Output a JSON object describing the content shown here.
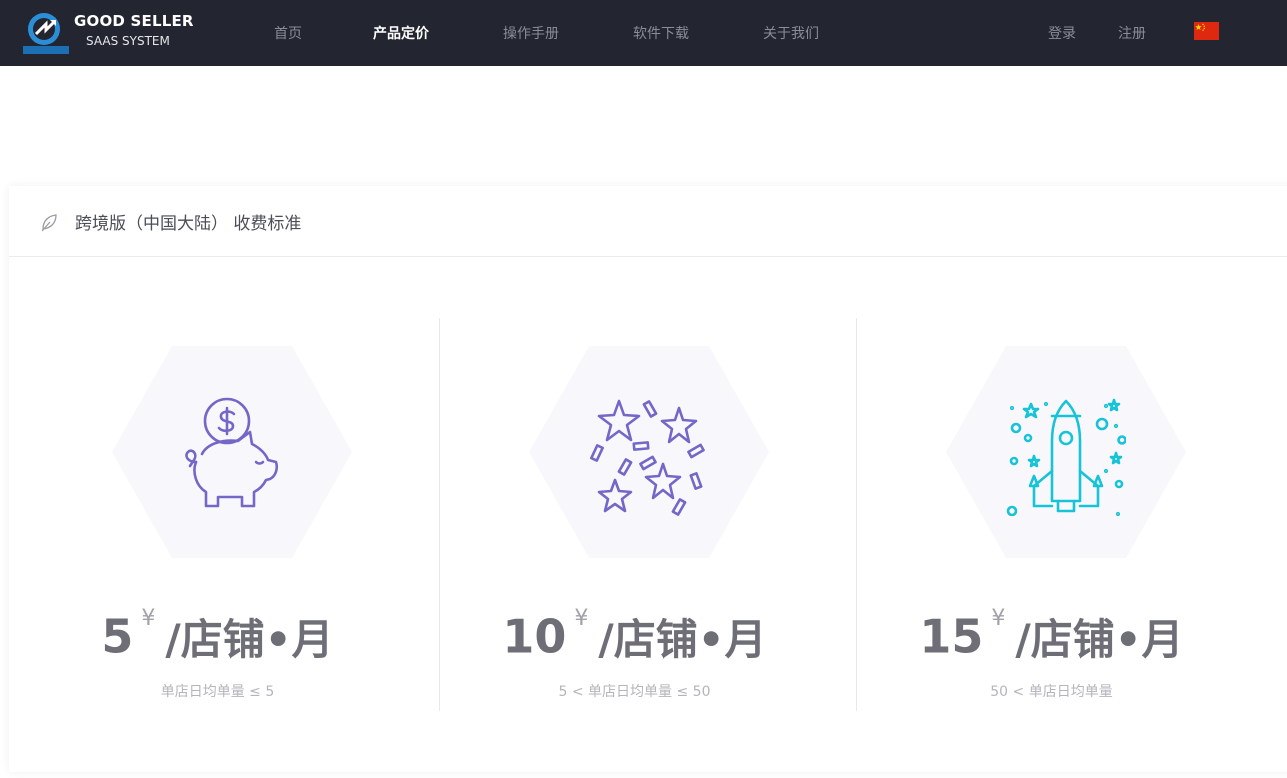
{
  "brand": {
    "title": "GOOD SELLER",
    "subtitle": "SAAS SYSTEM",
    "logo_text": "GOODSELLER"
  },
  "nav": {
    "items": [
      {
        "label": "首页",
        "active": false
      },
      {
        "label": "产品定价",
        "active": true
      },
      {
        "label": "操作手册",
        "active": false
      },
      {
        "label": "软件下载",
        "active": false
      },
      {
        "label": "关于我们",
        "active": false
      }
    ],
    "login": "登录",
    "register": "注册",
    "language_icon": "china-flag-icon"
  },
  "section": {
    "title": "跨境版（中国大陆） 收费标准",
    "icon": "leaf-icon"
  },
  "plans": [
    {
      "price": "5",
      "currency": "¥",
      "unit": "/店铺•月",
      "desc": "单店日均单量 ≤ 5",
      "icon": "piggy-bank-icon",
      "color": "#7367c7"
    },
    {
      "price": "10",
      "currency": "¥",
      "unit": "/店铺•月",
      "desc": "5 < 单店日均单量 ≤ 50",
      "icon": "stars-confetti-icon",
      "color": "#7367c7"
    },
    {
      "price": "15",
      "currency": "¥",
      "unit": "/店铺•月",
      "desc": "50 < 单店日均单量",
      "icon": "rocket-icon",
      "color": "#17c3d6"
    }
  ],
  "colors": {
    "navbar_bg": "#232531",
    "hexagon_bg": "#f8f8fc",
    "price_text": "#6d6e76",
    "desc_text": "#b4b5bc"
  }
}
